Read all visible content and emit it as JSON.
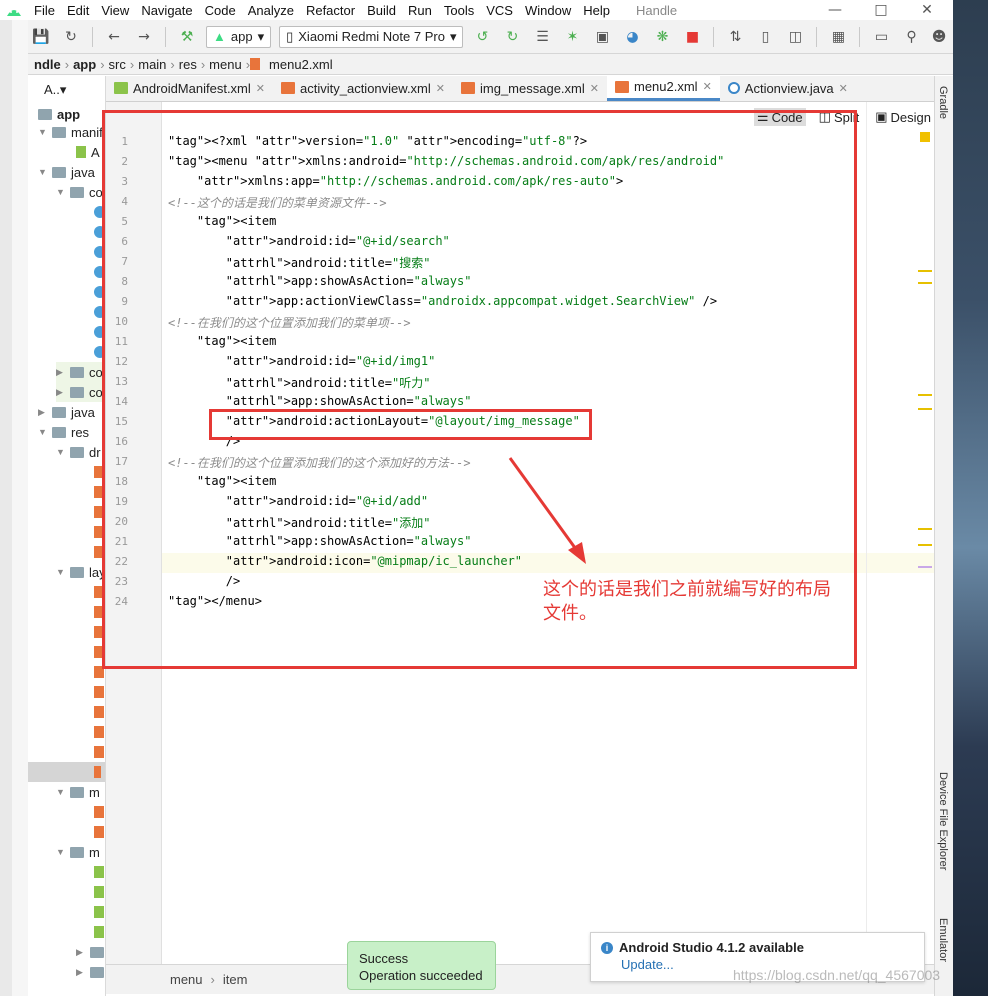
{
  "menubar": {
    "items": [
      "File",
      "Edit",
      "View",
      "Navigate",
      "Code",
      "Analyze",
      "Refactor",
      "Build",
      "Run",
      "Tools",
      "VCS",
      "Window",
      "Help"
    ],
    "window_title": "Handle"
  },
  "toolbar": {
    "module": "app",
    "device": "Xiaomi Redmi Note 7 Pro"
  },
  "breadcrumbs": [
    "ndle",
    "app",
    "src",
    "main",
    "res",
    "menu",
    "menu2.xml"
  ],
  "tree": {
    "root": "app",
    "items": [
      "A..▾",
      "manif",
      "A",
      "java",
      "co",
      "co",
      "co",
      "java",
      "res",
      "dr",
      "lay",
      "m",
      "m"
    ]
  },
  "tabs": [
    {
      "label": "AndroidManifest.xml",
      "type": "manifest"
    },
    {
      "label": "activity_actionview.xml",
      "type": "xml"
    },
    {
      "label": "img_message.xml",
      "type": "xml"
    },
    {
      "label": "menu2.xml",
      "type": "xml",
      "active": true
    },
    {
      "label": "Actionview.java",
      "type": "java"
    }
  ],
  "editor": {
    "view_modes": [
      "Code",
      "Split",
      "Design"
    ],
    "active_mode": "Code",
    "line_numbers": [
      "1",
      "2",
      "3",
      "4",
      "5",
      "6",
      "7",
      "8",
      "9",
      "10",
      "11",
      "12",
      "13",
      "14",
      "15",
      "16",
      "17",
      "18",
      "19",
      "20",
      "21",
      "22",
      "23",
      "24"
    ],
    "lines": [
      "<?xml version=\"1.0\" encoding=\"utf-8\"?>",
      "<menu xmlns:android=\"http://schemas.android.com/apk/res/android\"",
      "    xmlns:app=\"http://schemas.android.com/apk/res-auto\">",
      "<!--这个的话是我们的菜单资源文件-->",
      "    <item",
      "        android:id=\"@+id/search\"",
      "        android:title=\"搜索\"",
      "        app:showAsAction=\"always\"",
      "        app:actionViewClass=\"androidx.appcompat.widget.SearchView\" />",
      "<!--在我们的这个位置添加我们的菜单项-->",
      "    <item",
      "        android:id=\"@+id/img1\"",
      "        android:title=\"听力\"",
      "        app:showAsAction=\"always\"",
      "        android:actionLayout=\"@layout/img_message\"",
      "        />",
      "<!--在我们的这个位置添加我们的这个添加好的方法-->",
      "    <item",
      "        android:id=\"@+id/add\"",
      "        android:title=\"添加\"",
      "        app:showAsAction=\"always\"",
      "        android:icon=\"@mipmap/ic_launcher\"",
      "        />",
      "</menu>"
    ]
  },
  "annotation": {
    "callout": "这个的话是我们之前就编写好的布局文件。"
  },
  "right_tools": [
    "Gradle",
    "Device File Explorer",
    "Emulator"
  ],
  "status_breadcrumb": [
    "menu",
    "item"
  ],
  "toast": {
    "title": "Success",
    "message": "Operation succeeded"
  },
  "notification": {
    "title": "Android Studio 4.1.2 available",
    "link": "Update..."
  },
  "watermark": "https://blog.csdn.net/qq_4567003"
}
